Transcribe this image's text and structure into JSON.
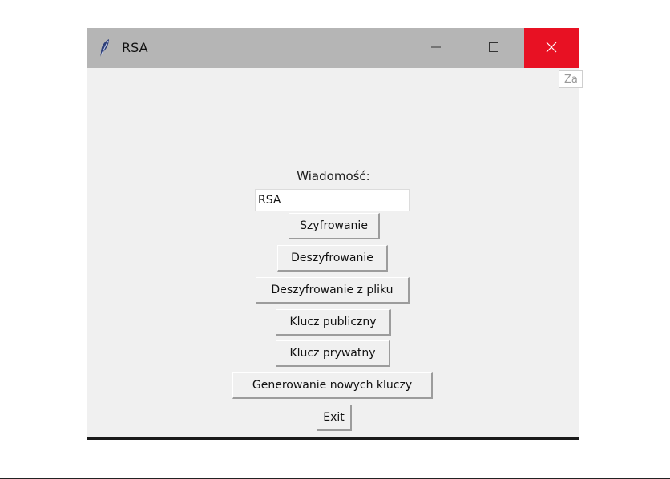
{
  "window": {
    "title": "RSA",
    "minimize_symbol": "—",
    "close_color": "#e81123",
    "titlebar_color": "#b5b5b5",
    "background_color": "#f0f0f0"
  },
  "tooltip": {
    "text": "Za"
  },
  "form": {
    "message_label": "Wiadomość:",
    "message_value": "RSA",
    "buttons": {
      "encrypt": "Szyfrowanie",
      "decrypt": "Deszyfrowanie",
      "decrypt_file": "Deszyfrowanie z pliku",
      "public_key": "Klucz publiczny",
      "private_key": "Klucz prywatny",
      "generate_keys": "Generowanie nowych kluczy",
      "exit": "Exit"
    }
  },
  "icons": {
    "app": "feather-icon",
    "minimize": "minimize-icon",
    "maximize": "maximize-icon",
    "close": "close-icon"
  }
}
